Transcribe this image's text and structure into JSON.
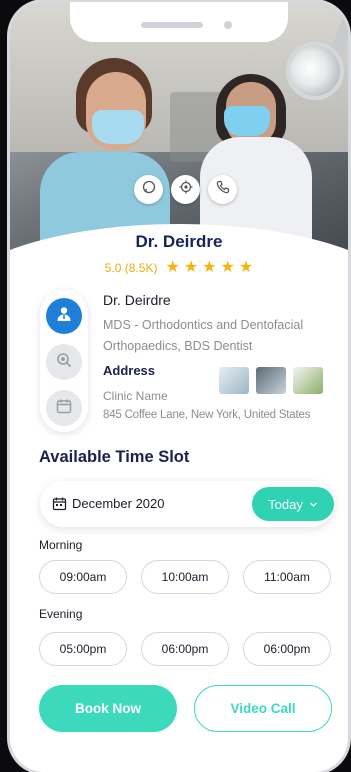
{
  "doctor": {
    "name": "Dr. Deirdre",
    "rating_text": "5.0 (8.5K)",
    "stars": 5,
    "details_name": "Dr. Deirdre",
    "qualifications": "MDS - Orthodontics and Dentofacial Orthopaedics, BDS Dentist"
  },
  "address": {
    "title": "Address",
    "clinic_name": "Clinic Name",
    "line": "845 Coffee Lane, New York, United States"
  },
  "quick_actions": [
    "chat-icon",
    "location-icon",
    "phone-icon"
  ],
  "side_rail": [
    "doctor-icon",
    "microscope-icon",
    "calendar-icon"
  ],
  "schedule": {
    "title": "Available Time Slot",
    "month": "December 2020",
    "today_label": "Today",
    "morning_label": "Morning",
    "morning_slots": [
      "09:00am",
      "10:00am",
      "11:00am"
    ],
    "evening_label": "Evening",
    "evening_slots": [
      "05:00pm",
      "06:00pm",
      "06:00pm"
    ]
  },
  "actions": {
    "book_label": "Book Now",
    "video_label": "Video Call"
  },
  "colors": {
    "accent": "#2fd3b4",
    "primary_text": "#17235f",
    "star": "#f6b50e",
    "rail_active": "#1f7fd8"
  }
}
